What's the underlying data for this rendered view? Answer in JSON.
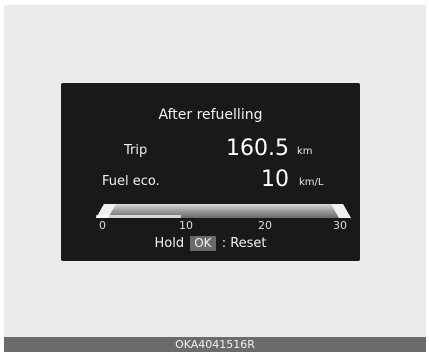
{
  "screen": {
    "title": "After refuelling",
    "trip": {
      "label": "Trip",
      "value": "160.5",
      "unit": "km"
    },
    "fuel_eco": {
      "label": "Fuel eco.",
      "value": "10",
      "unit": "km/L"
    },
    "gauge": {
      "ticks": [
        "0",
        "10",
        "20",
        "30"
      ],
      "current_value": 10,
      "max_value": 30
    },
    "hold": {
      "prefix": "Hold",
      "button": "OK",
      "suffix": ": Reset"
    }
  },
  "caption": "OKA4041516R"
}
